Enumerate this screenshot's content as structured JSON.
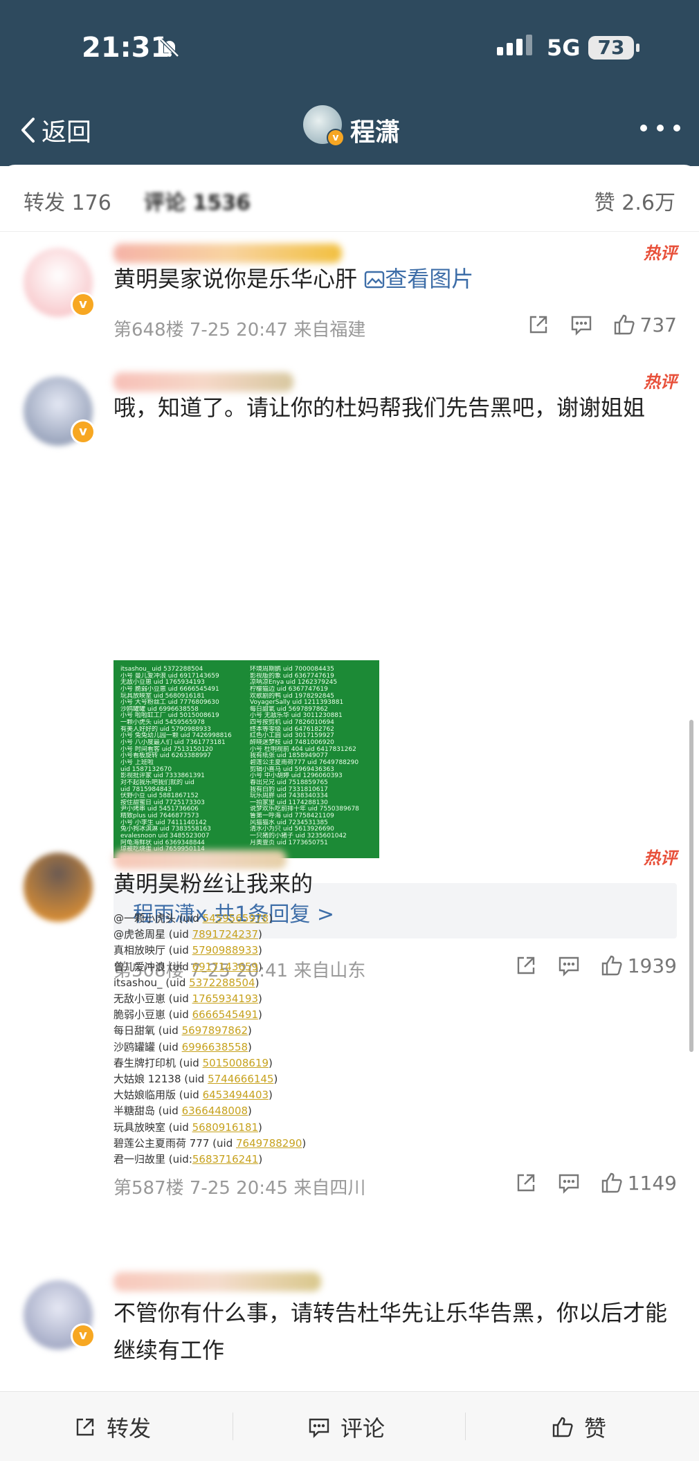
{
  "status_bar": {
    "time": "21:31",
    "network": "5G",
    "battery": "73"
  },
  "nav": {
    "back_label": "返回",
    "title": "程潇",
    "badge": "v"
  },
  "tabs": {
    "repost": "转发 176",
    "comments": "评论 1536",
    "likes": "赞 2.6万"
  },
  "hot_label": "热评",
  "comments": [
    {
      "text": "黄明昊家说你是乐华心肝",
      "link": "查看图片",
      "meta": "第648楼 7-25 20:47 来自福建",
      "likes": "737"
    },
    {
      "text": "哦，知道了。请让你的杜妈帮我们先告黑吧，谢谢姐姐",
      "image_lines_left": [
        "itsashou_ uid 5372288504",
        "小号 曼儿爱冲浪 uid 6917143659",
        "无敌小豆崽 uid 1765934193",
        "小号 脆弱小豆崽 uid 6666545491",
        "玩具放映室 uid 5680916181",
        "小号 大号粉丝工 uid 7776809630",
        "沙鸥罐罐 uid 6996638558",
        "小号 啦啦缸工厂 uid 5015008619",
        "一颗小虎头 uid 5459565978",
        "有美人好好的 uid 5790988933",
        "小号 兔兔幼儿园一颗 uid 7426998816",
        "小号 八小度最人们 uid 7361773181",
        "小号 时间看客 uid 7513150120",
        "小号看板旋转 uid 6263388997",
        "小号 上班啦",
        "uid 1587132670",
        "影视批评家 uid 7333861391",
        "对不起我乐吧我们就的 uid",
        "uid 7815984843",
        "伏野小豆 uid 5881867152",
        "按住甜蜜日 uid 7725173303",
        "尹小烤串 uid 5451736606",
        "精致plus uid 7646877573",
        "小号 小李生 uid 7411140142",
        "兔小狗冰淇淋 uid 7383558163",
        "evalesnoon uid 3485523007",
        "阿龟海鲜状 uid 6369348844",
        "琼被吃烧蛋 uid 7659950114"
      ],
      "image_lines_right": [
        "环境周期鹅 uid 7000084435",
        "影视版的象 uid 6367747619",
        "凉呐凉Enya uid 1262379245",
        "柠檬猫边 uid 6367747619",
        "欢歌剧的鸭 uid 1978292845",
        "VoyagerSally uid 1211393881",
        "每日甜氧 uid 5697897862",
        "小号 无敌乐华 uid 3011230881",
        "四号按剪机 uid 7826010694",
        "终本等零级 uid 6476182762",
        "红色小工圆 uid 3017159927",
        "醉晓迷梦枝 uid 7481006920",
        "小号 杜明视前 404 uid 6417831262",
        "我有纸张 uid 1858949077",
        "碧莲公主夏雨荷777 uid 7649788290",
        "剪辑小喜马 uid 5969436363",
        "小号 中小胡婷 uid 1296060393",
        "春出兄兄 uid 7518859765",
        "我有白豹 uid 7331810617",
        "玩乐周胖 uid 7438340334",
        "一拍家里 uid 1174288130",
        "说梦欢乐吃前排十年 uid 7550389678",
        "鲁第一呼海 uid 7758421109",
        "风猫猫水 uid 7234531385",
        "清水小为只 uid 5613926690",
        "一只猪的小猪子 uid 3235601042",
        "月奥壹页 uid 1773650751"
      ],
      "reply_box": "程雨潇x 共1条回复 >",
      "meta": "第508楼 7-25 20:41 来自山东",
      "likes": "1939"
    },
    {
      "text": "黄明昊粉丝让我来的",
      "uid_list": [
        {
          "name": "@一颗小虎头 (uid ",
          "uid": "5459565978",
          "end": ")"
        },
        {
          "name": "@虎爸周星 (uid ",
          "uid": "7891724237",
          "end": ")"
        },
        {
          "name": "真相放映厅 (uid ",
          "uid": "5790988933",
          "end": ")"
        },
        {
          "name": "曾儿爱冲浪 (uid ",
          "uid": "6917143659",
          "end": ")"
        },
        {
          "name": "itsashou_ (uid ",
          "uid": "5372288504",
          "end": ")"
        },
        {
          "name": "无敌小豆崽 (uid ",
          "uid": "1765934193",
          "end": ")"
        },
        {
          "name": "脆弱小豆崽 (uid ",
          "uid": "6666545491",
          "end": ")"
        },
        {
          "name": "每日甜氧 (uid ",
          "uid": "5697897862",
          "end": ")"
        },
        {
          "name": "沙鸥罐罐 (uid ",
          "uid": "6996638558",
          "end": ")"
        },
        {
          "name": "春生牌打印机 (uid ",
          "uid": "5015008619",
          "end": ")"
        },
        {
          "name": "大姑娘 12138 (uid ",
          "uid": "5744666145",
          "end": ")"
        },
        {
          "name": "大姑娘临用版 (uid ",
          "uid": "6453494403",
          "end": ")"
        },
        {
          "name": "半糖甜岛 (uid ",
          "uid": "6366448008",
          "end": ")"
        },
        {
          "name": "玩具放映室 (uid ",
          "uid": "5680916181",
          "end": ")"
        },
        {
          "name": "碧莲公主夏雨荷 777 (uid ",
          "uid": "7649788290",
          "end": ")"
        },
        {
          "name": "君一归故里 (uid:",
          "uid": "5683716241",
          "end": ")"
        }
      ],
      "meta": "第587楼 7-25 20:45 来自四川",
      "likes": "1149"
    },
    {
      "text": "不管你有什么事，请转告杜华先让乐华告黑，你以后才能继续有工作"
    }
  ],
  "bottom_bar": {
    "repost": "转发",
    "comment": "评论",
    "like": "赞"
  },
  "colors": {
    "header_bg": "#2e4a5e",
    "link": "#3e6ea8",
    "hot": "#e8503a",
    "image_bg": "#1c8a36",
    "uid_highlight": "#c7a21e"
  }
}
